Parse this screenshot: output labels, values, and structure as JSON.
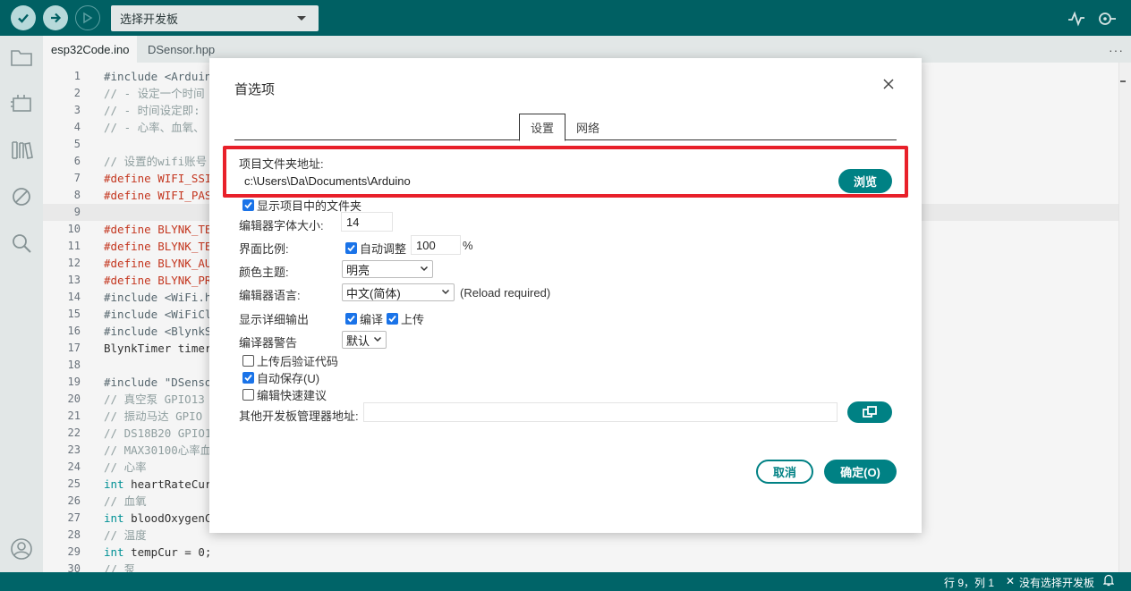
{
  "colors": {
    "toolbar": "#006468",
    "accent": "#008184",
    "highlight": "#e8202a",
    "checkbox": "#1a73e8"
  },
  "toolbar": {
    "verify_icon": "check-icon",
    "upload_icon": "arrow-right-icon",
    "debug_icon": "debug-icon",
    "board_select_label": "选择开发板",
    "serial_plotter_icon": "pulse-icon",
    "serial_monitor_icon": "monitor-icon"
  },
  "sidebar": {
    "icons": [
      "folder-icon",
      "board-icon",
      "library-icon",
      "debug-off-icon",
      "search-icon",
      "account-icon"
    ]
  },
  "tabs": [
    {
      "label": "esp32Code.ino"
    },
    {
      "label": "DSensor.hpp"
    }
  ],
  "tabs_more": "···",
  "editor": {
    "lines": [
      {
        "n": "1",
        "text": "#include <Arduin",
        "k": "inc"
      },
      {
        "n": "2",
        "text": "// - 设定一个时间",
        "k": "cmt"
      },
      {
        "n": "3",
        "text": "// - 时间设定即:",
        "k": "cmt"
      },
      {
        "n": "4",
        "text": "// - 心率、血氧、",
        "k": "cmt"
      },
      {
        "n": "5",
        "text": "",
        "k": ""
      },
      {
        "n": "6",
        "text": "// 设置的wifi账号",
        "k": "cmt"
      },
      {
        "n": "7",
        "text": "#define WIFI_SSI",
        "k": "def"
      },
      {
        "n": "8",
        "text": "#define WIFI_PAS",
        "k": "def"
      },
      {
        "n": "9",
        "text": "",
        "k": ""
      },
      {
        "n": "10",
        "text": "#define BLYNK_TE",
        "k": "def"
      },
      {
        "n": "11",
        "text": "#define BLYNK_TE",
        "k": "def"
      },
      {
        "n": "12",
        "text": "#define BLYNK_AU",
        "k": "def"
      },
      {
        "n": "13",
        "text": "#define BLYNK_PR",
        "k": "def"
      },
      {
        "n": "14",
        "text": "#include <WiFi.h",
        "k": "inc"
      },
      {
        "n": "15",
        "text": "#include <WiFiCl",
        "k": "inc"
      },
      {
        "n": "16",
        "text": "#include <BlynkS",
        "k": "inc"
      },
      {
        "n": "17",
        "text": "BlynkTimer timer",
        "k": ""
      },
      {
        "n": "18",
        "text": "",
        "k": ""
      },
      {
        "n": "19",
        "text": "#include \"DSenso",
        "k": "inc"
      },
      {
        "n": "20",
        "text": "// 真空泵 GPIO13",
        "k": "cmt"
      },
      {
        "n": "21",
        "text": "// 振动马达 GPIO",
        "k": "cmt"
      },
      {
        "n": "22",
        "text": "// DS18B20 GPIO1",
        "k": "cmt"
      },
      {
        "n": "23",
        "text": "// MAX30100心率血",
        "k": "cmt"
      },
      {
        "n": "24",
        "text": "// 心率",
        "k": "cmt"
      },
      {
        "n": "25",
        "text": "int heartRateCur",
        "k": "int"
      },
      {
        "n": "26",
        "text": "// 血氧",
        "k": "cmt"
      },
      {
        "n": "27",
        "text": "int bloodOxygenC",
        "k": "int"
      },
      {
        "n": "28",
        "text": "// 温度",
        "k": "cmt"
      },
      {
        "n": "29",
        "text": "int tempCur = 0;",
        "k": "int"
      },
      {
        "n": "30",
        "text": "// 泵",
        "k": "cmt"
      }
    ]
  },
  "dialog": {
    "title": "首选项",
    "close_icon": "close-icon",
    "tabs": [
      {
        "label": "设置"
      },
      {
        "label": "网络"
      }
    ],
    "sketchbook_label": "项目文件夹地址:",
    "sketchbook_value": "c:\\Users\\Da\\Documents\\Arduino",
    "browse_label": "浏览",
    "show_files_label": "显示项目中的文件夹",
    "font_size_label": "编辑器字体大小:",
    "font_size_value": "14",
    "scale_label": "界面比例:",
    "auto_scale_label": "自动调整",
    "scale_value": "100",
    "scale_unit": "%",
    "theme_label": "颜色主题:",
    "theme_value": "明亮",
    "language_label": "编辑器语言:",
    "language_value": "中文(简体)",
    "language_note": "(Reload required)",
    "verbose_label": "显示详细输出",
    "verbose_compile_label": "编译",
    "verbose_upload_label": "上传",
    "warnings_label": "编译器警告",
    "warnings_value": "默认",
    "verify_after_upload_label": "上传后验证代码",
    "autosave_label": "自动保存(U)",
    "quick_suggestions_label": "编辑快速建议",
    "board_urls_label": "其他开发板管理器地址:",
    "board_urls_value": "",
    "board_urls_button_icon": "window-icon",
    "cancel_label": "取消",
    "ok_label": "确定(O)"
  },
  "status": {
    "position": "行 9，列 1",
    "board": "没有选择开发板",
    "close_icon": "x-icon",
    "bell_icon": "bell-icon"
  }
}
